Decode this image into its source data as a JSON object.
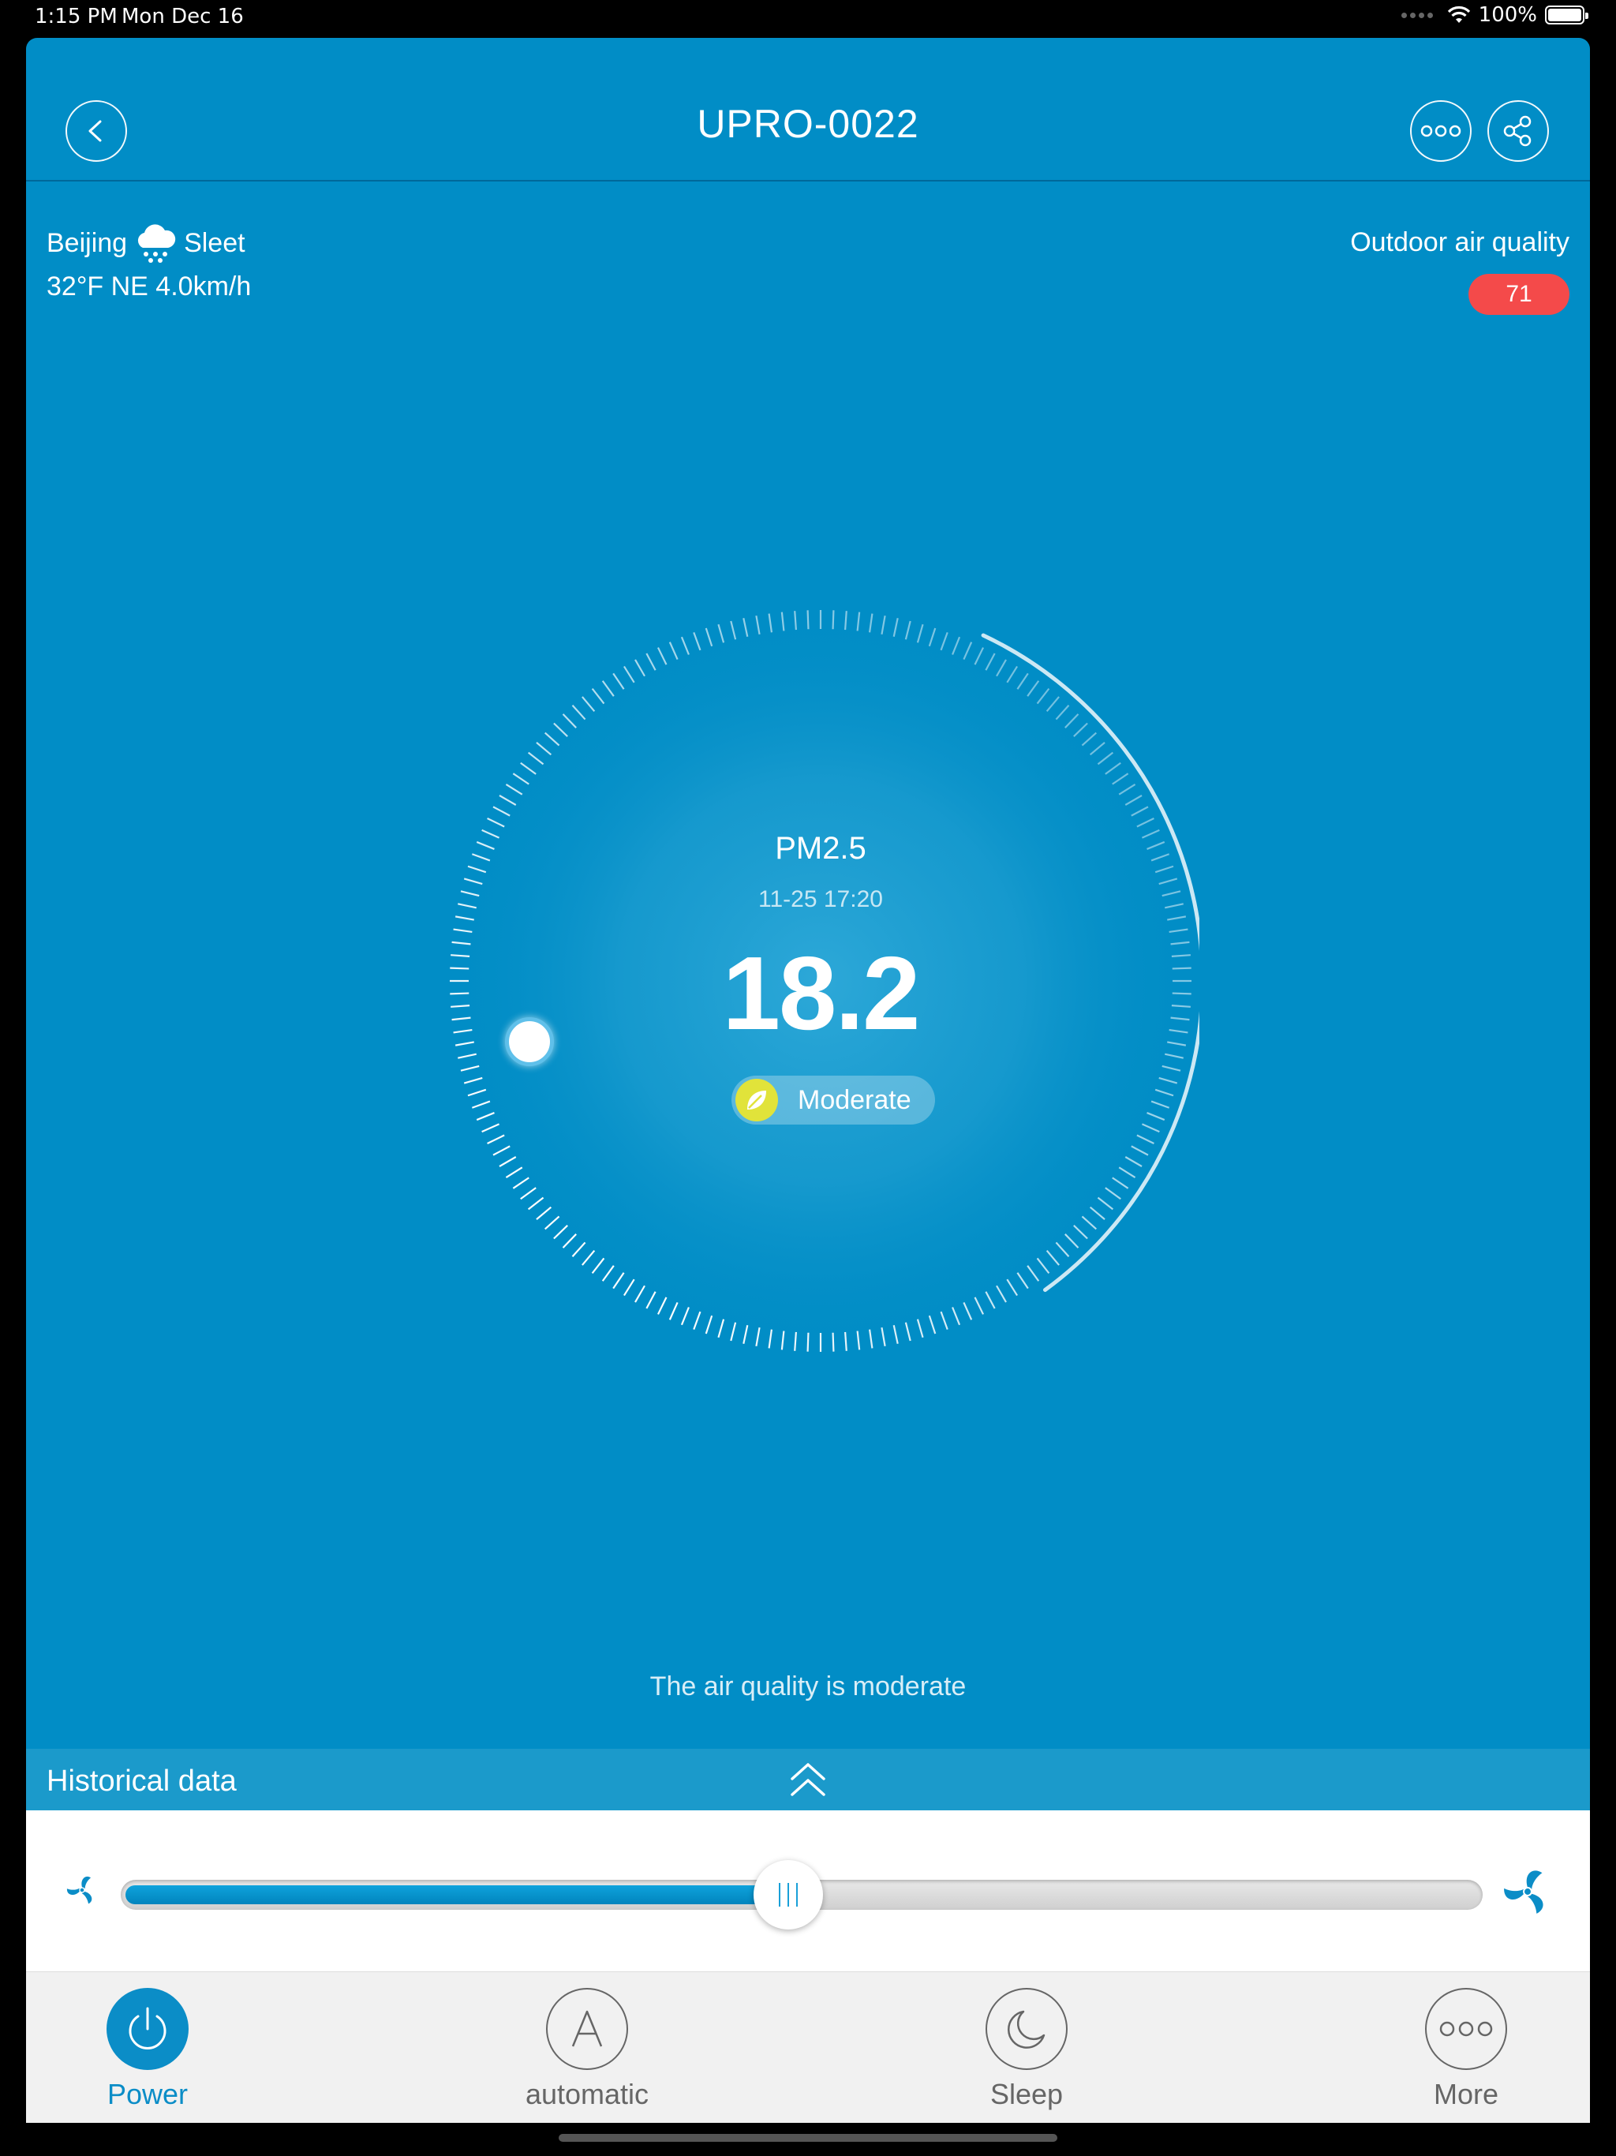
{
  "status_bar": {
    "time": "1:15 PM",
    "date": "Mon Dec 16",
    "battery": "100%"
  },
  "header": {
    "title": "UPRO-0022"
  },
  "weather": {
    "city": "Beijing",
    "condition": "Sleet",
    "details": "32°F  NE 4.0km/h",
    "icon": "sleet-icon"
  },
  "outdoor": {
    "label": "Outdoor air quality",
    "aqi": "71",
    "aqi_color": "#f44a4a"
  },
  "gauge": {
    "pollutant": "PM2.5",
    "timestamp": "11-25 17:20",
    "value": "18.2",
    "status": "Moderate"
  },
  "message": "The air quality is moderate",
  "historical": {
    "label": "Historical data"
  },
  "fan_speed": {
    "level_percent": 49
  },
  "tabs": [
    {
      "label": "Power",
      "icon": "power-icon",
      "active": true
    },
    {
      "label": "automatic",
      "icon": "automatic-icon",
      "active": false
    },
    {
      "label": "Sleep",
      "icon": "moon-icon",
      "active": false
    },
    {
      "label": "More",
      "icon": "more-icon",
      "active": false
    }
  ],
  "colors": {
    "background": "#018dc6",
    "accent": "#0b8dc7",
    "badge": "#f44a4a"
  }
}
